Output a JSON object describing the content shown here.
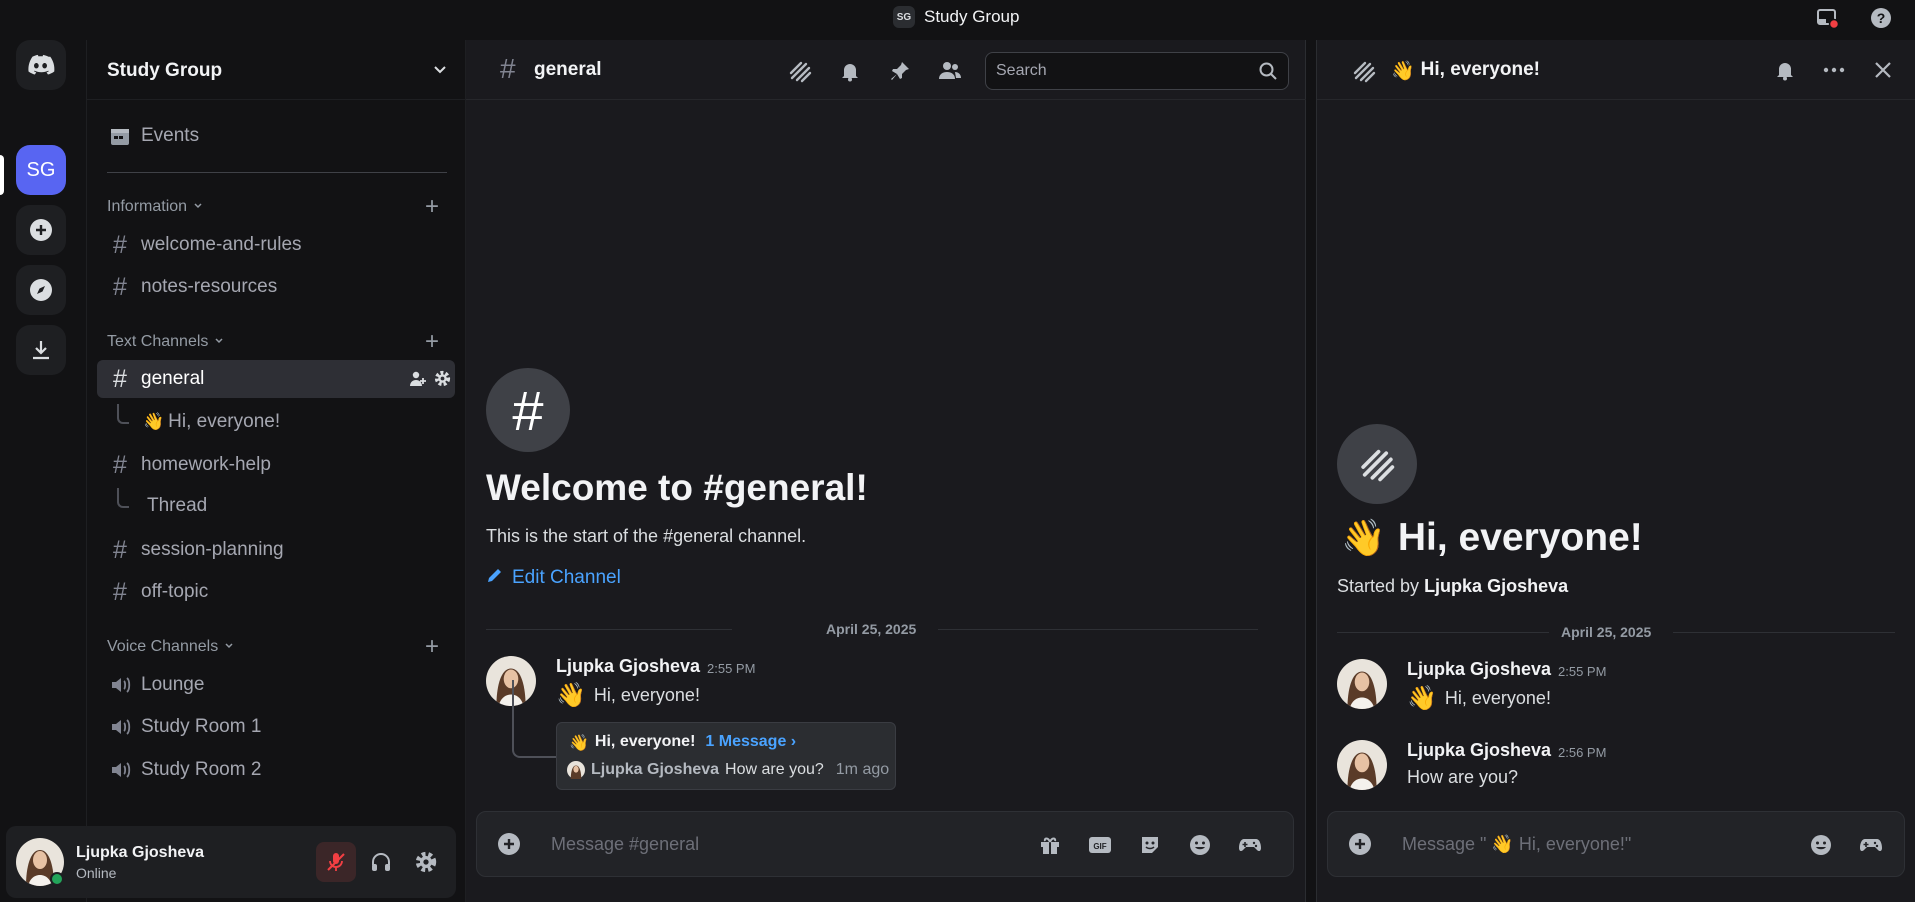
{
  "titlebar": {
    "server_initials": "SG",
    "title": "Study Group"
  },
  "servers": {
    "active_initials": "SG"
  },
  "guild": {
    "name": "Study Group"
  },
  "sidebar": {
    "events_label": "Events",
    "categories": {
      "information": "Information",
      "text": "Text Channels",
      "voice": "Voice Channels"
    },
    "channels": {
      "welcome": "welcome-and-rules",
      "notes": "notes-resources",
      "general": "general",
      "general_thread": "Hi, everyone!",
      "homework": "homework-help",
      "homework_thread": "Thread",
      "session": "session-planning",
      "offtopic": "off-topic"
    },
    "voice_channels": [
      "Lounge",
      "Study Room 1",
      "Study Room 2"
    ]
  },
  "user": {
    "name": "Ljupka Gjosheva",
    "status": "Online"
  },
  "main": {
    "channel_name": "general",
    "search_placeholder": "Search",
    "welcome_title": "Welcome to #general!",
    "welcome_sub": "This is the start of the #general channel.",
    "edit_channel": "Edit Channel",
    "date": "April 25, 2025",
    "message": {
      "author": "Ljupka Gjosheva",
      "time": "2:55 PM",
      "text": "Hi, everyone!"
    },
    "thread_card": {
      "title": "Hi, everyone!",
      "count": "1 Message ›",
      "last_author": "Ljupka Gjosheva",
      "last_text": "How are you?",
      "last_time": "1m ago"
    },
    "composer_placeholder": "Message #general"
  },
  "thread_panel": {
    "title": "Hi, everyone!",
    "big_title": "Hi, everyone!",
    "started_by_prefix": "Started by",
    "started_by_name": "Ljupka Gjosheva",
    "date": "April 25, 2025",
    "messages": [
      {
        "author": "Ljupka Gjosheva",
        "time": "2:55 PM",
        "text": "Hi, everyone!"
      },
      {
        "author": "Ljupka Gjosheva",
        "time": "2:56 PM",
        "text": "How are you?"
      }
    ],
    "composer_placeholder": "Message \" 👋 Hi, everyone!\""
  },
  "colors": {
    "accent": "#5865f2",
    "link": "#4aa3ff",
    "online": "#23a55a",
    "muted_red": "#f23f43"
  }
}
